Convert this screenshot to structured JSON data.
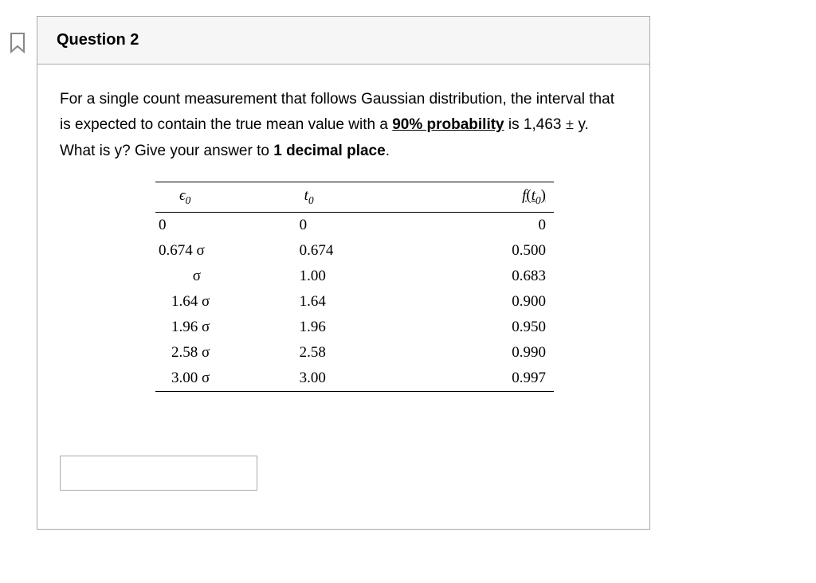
{
  "question": {
    "title": "Question 2",
    "text_part1": "For a single count measurement that follows Gaussian distribution, the interval that is expected to contain the true mean value with a ",
    "highlight1": "90% probability",
    "text_part2": " is 1,463 ",
    "pm": "±",
    "text_part3": " y. What is y? Give your answer to ",
    "highlight2": "1 decimal place",
    "text_part4": "."
  },
  "table": {
    "headers": {
      "col1_symbol": "ϵ",
      "col1_sub": "0",
      "col2_symbol": "t",
      "col2_sub": "0",
      "col3_f": "f",
      "col3_open": "(",
      "col3_t": "t",
      "col3_sub": "0",
      "col3_close": ")"
    },
    "rows": [
      {
        "c1": "0",
        "c2": "0",
        "c3": "0"
      },
      {
        "c1": "0.674 σ",
        "c2": "0.674",
        "c3": "0.500"
      },
      {
        "c1": "         σ",
        "c2": "1.00",
        "c3": "0.683"
      },
      {
        "c1": "1.64 σ",
        "c2": "1.64",
        "c3": "0.900"
      },
      {
        "c1": "1.96 σ",
        "c2": "1.96",
        "c3": "0.950"
      },
      {
        "c1": "2.58 σ",
        "c2": "2.58",
        "c3": "0.990"
      },
      {
        "c1": "3.00 σ",
        "c2": "3.00",
        "c3": "0.997"
      }
    ]
  },
  "answer": {
    "value": "",
    "placeholder": ""
  }
}
